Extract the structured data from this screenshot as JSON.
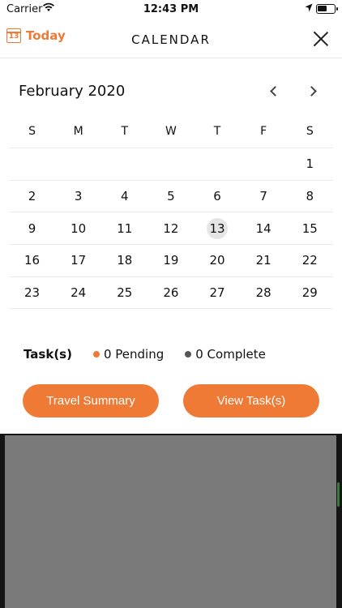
{
  "status_bar": {
    "carrier": "Carrier",
    "time": "12:43 PM"
  },
  "header": {
    "today_label": "Today",
    "today_icon_day": "13",
    "title": "CALENDAR"
  },
  "calendar": {
    "month_label": "February 2020",
    "weekdays": [
      "S",
      "M",
      "T",
      "W",
      "T",
      "F",
      "S"
    ],
    "weeks": [
      [
        "",
        "",
        "",
        "",
        "",
        "",
        "1"
      ],
      [
        "2",
        "3",
        "4",
        "5",
        "6",
        "7",
        "8"
      ],
      [
        "9",
        "10",
        "11",
        "12",
        "13",
        "14",
        "15"
      ],
      [
        "16",
        "17",
        "18",
        "19",
        "20",
        "21",
        "22"
      ],
      [
        "23",
        "24",
        "25",
        "26",
        "27",
        "28",
        "29"
      ]
    ],
    "today": "13"
  },
  "tasks": {
    "label": "Task(s)",
    "pending": "0 Pending",
    "complete": "0 Complete",
    "pending_color": "#ee7a36",
    "complete_color": "#555555"
  },
  "buttons": {
    "travel_summary": "Travel Summary",
    "view_tasks": "View Task(s)"
  },
  "colors": {
    "accent": "#ee7a36"
  }
}
